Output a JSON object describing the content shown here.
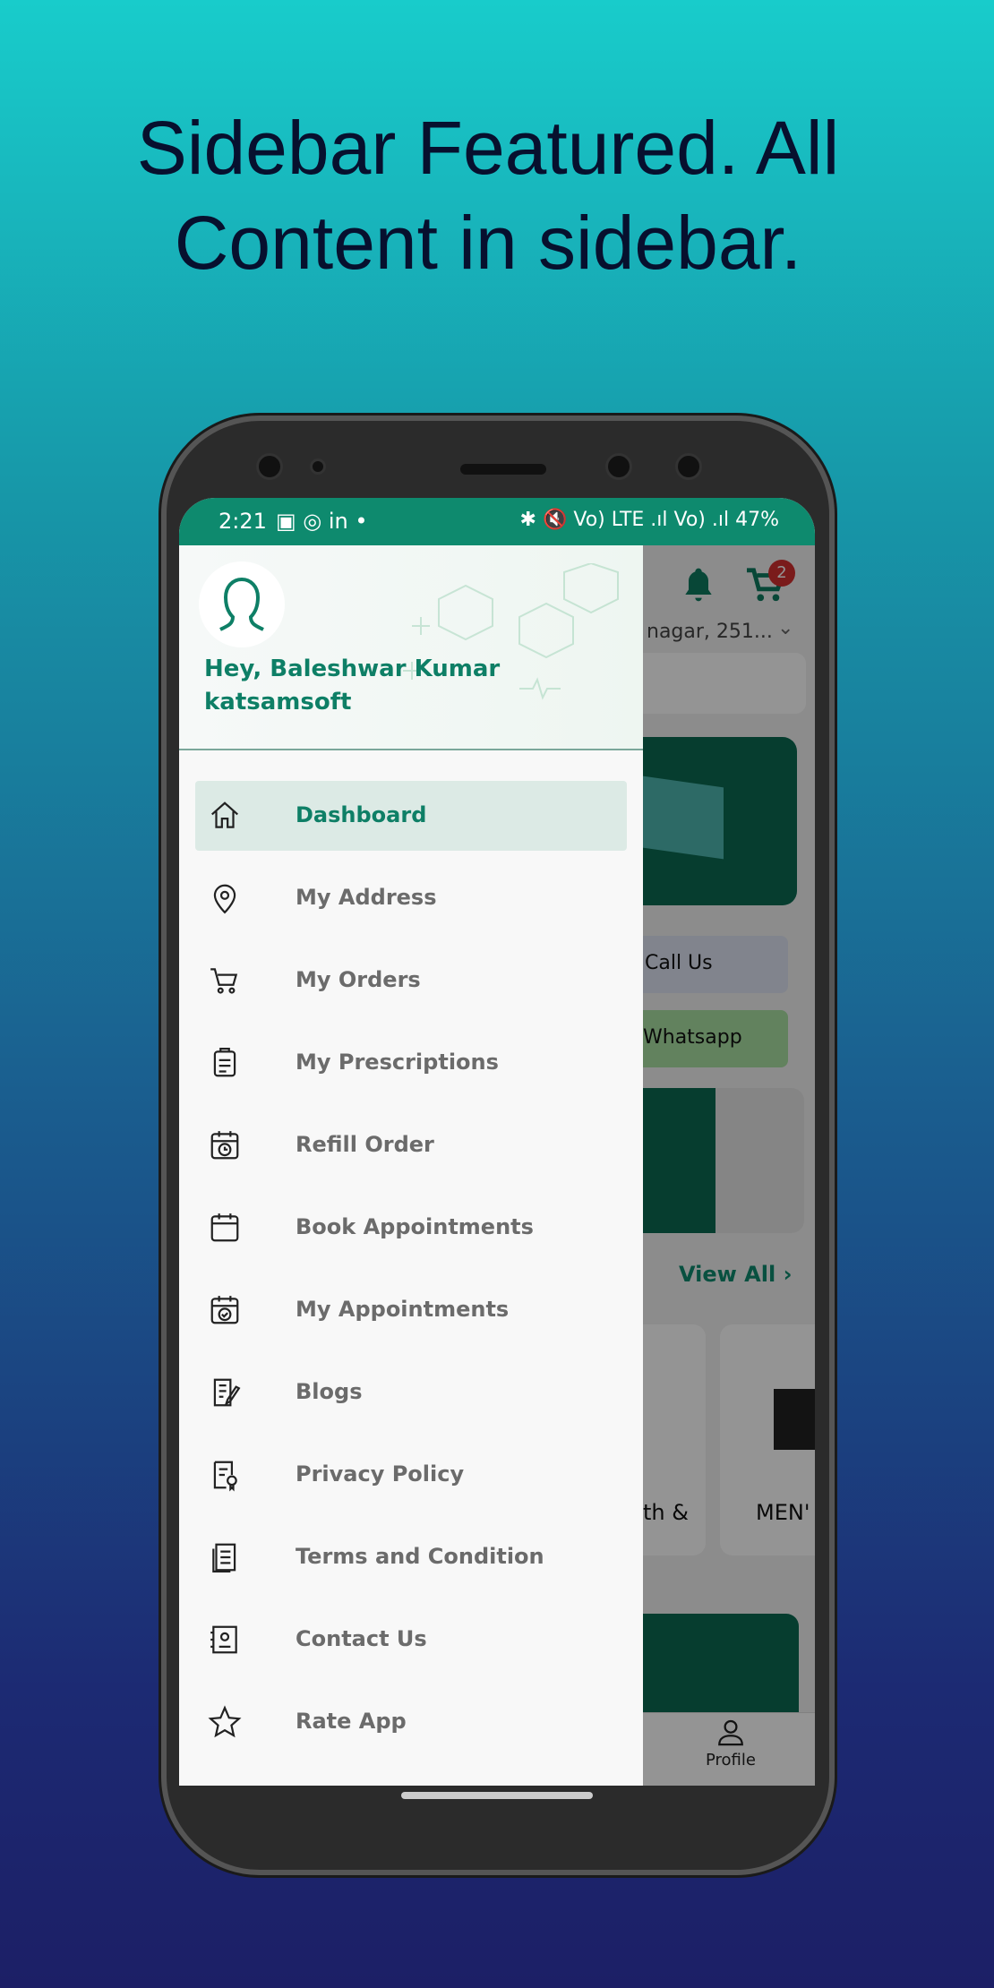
{
  "headline": {
    "line1": "Sidebar Featured. All",
    "line2": "Content in sidebar."
  },
  "colors": {
    "brand": "#0e8a6e",
    "active_bg": "#dceae5",
    "badge": "#d32f2f"
  },
  "status_bar": {
    "time": "2:21",
    "right": "✱ 🔇 Vo) LTE .ıl Vo) .ıl 47%",
    "battery": "47%"
  },
  "drawer": {
    "greeting_line1": "Hey, Baleshwar Kumar",
    "greeting_line2": "katsamsoft",
    "items": [
      {
        "label": "Dashboard",
        "icon": "home-icon",
        "active": true
      },
      {
        "label": "My Address",
        "icon": "location-pin-icon"
      },
      {
        "label": "My Orders",
        "icon": "cart-icon"
      },
      {
        "label": "My Prescriptions",
        "icon": "prescription-icon"
      },
      {
        "label": "Refill Order",
        "icon": "calendar-clock-icon"
      },
      {
        "label": "Book Appointments",
        "icon": "calendar-icon"
      },
      {
        "label": "My Appointments",
        "icon": "calendar-check-icon"
      },
      {
        "label": "Blogs",
        "icon": "blog-icon"
      },
      {
        "label": "Privacy Policy",
        "icon": "policy-icon"
      },
      {
        "label": "Terms and Condition",
        "icon": "document-icon"
      },
      {
        "label": "Contact Us",
        "icon": "contact-icon"
      },
      {
        "label": "Rate App",
        "icon": "star-icon"
      }
    ]
  },
  "background_app": {
    "cart_count": "2",
    "location": "nagar, 251...",
    "call_us": "Call Us",
    "whatsapp": "Whatsapp",
    "view_all": "View All",
    "category1": "th &",
    "category2": "MEN'",
    "profile_tab": "Profile"
  }
}
